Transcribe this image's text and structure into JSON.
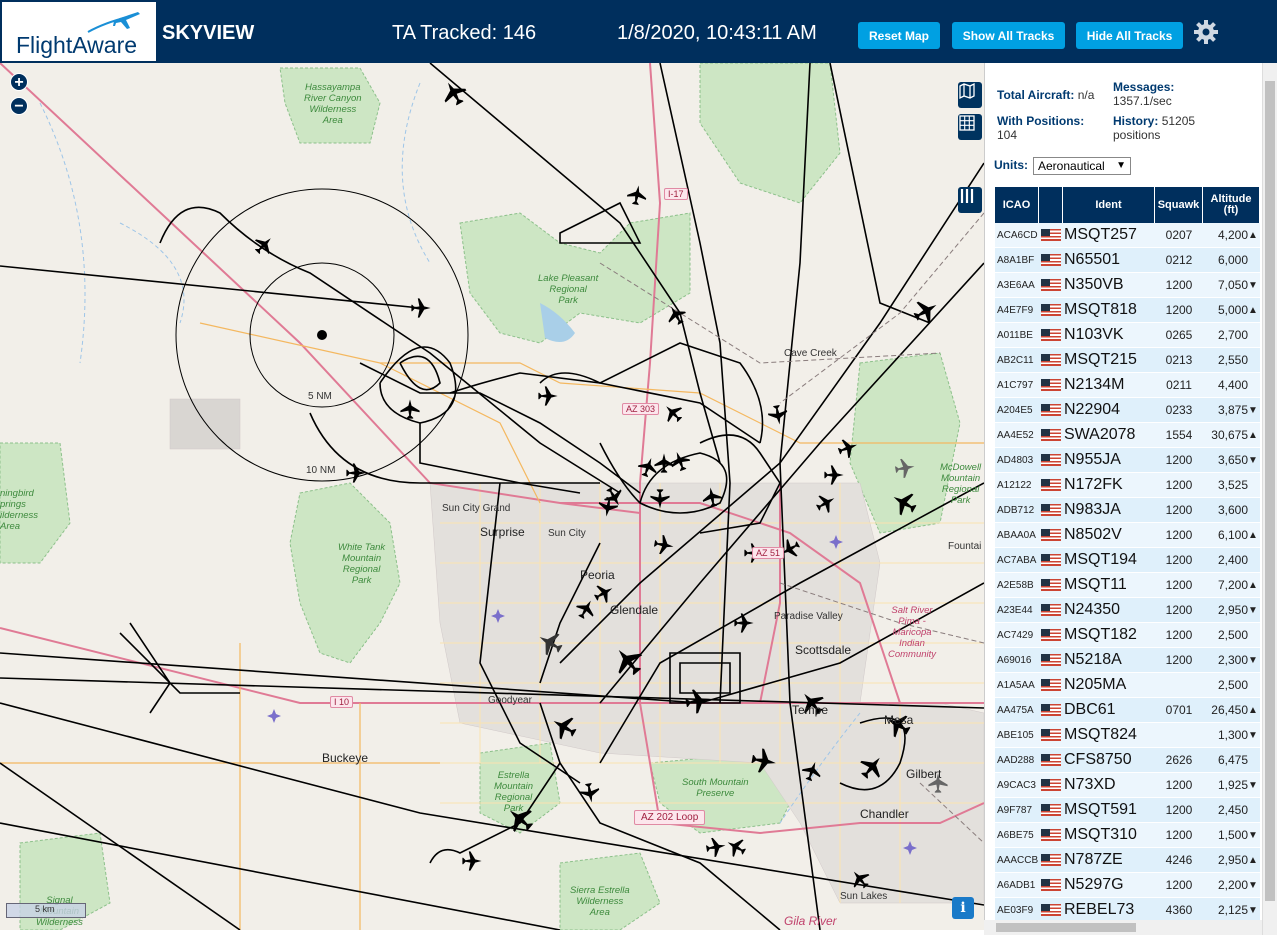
{
  "header": {
    "logo_text": "FlightAware",
    "app_title": "SKYVIEW",
    "tracked": "TA Tracked: 146",
    "clock": "1/8/2020, 10:43:11 AM",
    "reset_label": "Reset Map",
    "show_label": "Show All Tracks",
    "hide_label": "Hide All Tracks",
    "settings_icon": "gear-icon"
  },
  "map": {
    "zoom_in": "+",
    "zoom_out": "−",
    "scale": "5 km",
    "info": "i",
    "range_labels": [
      "5 NM",
      "10 NM"
    ],
    "places": [
      {
        "text": "Hassayampa\nRiver Canyon\nWilderness\nArea",
        "kind": "green"
      },
      {
        "text": "Lake Pleasant\nRegional\nPark",
        "kind": "green"
      },
      {
        "text": "White Tank\nMountain\nRegional\nPark",
        "kind": "green"
      },
      {
        "text": "McDowell\nMountain\nRegional\nPark",
        "kind": "green"
      },
      {
        "text": "Estrella\nMountain\nRegional\nPark",
        "kind": "green"
      },
      {
        "text": "South Mountain\nPreserve",
        "kind": "green"
      },
      {
        "text": "Sierra Estrella\nWilderness\nArea",
        "kind": "green"
      },
      {
        "text": "Signal\nMountain\nWilderness",
        "kind": "green"
      },
      {
        "text": "ningbird\nprings\nilderness\nArea",
        "kind": "green"
      },
      {
        "text": "Salt River\nPima -\nMaricopa\nIndian\nCommunity",
        "kind": "red"
      },
      {
        "text": "Cave Creek",
        "kind": "plain"
      },
      {
        "text": "Sun City Grand",
        "kind": "plain"
      },
      {
        "text": "Sun City",
        "kind": "plain"
      },
      {
        "text": "Surprise",
        "kind": "city"
      },
      {
        "text": "Peoria",
        "kind": "city"
      },
      {
        "text": "Glendale",
        "kind": "city"
      },
      {
        "text": "Paradise Valley",
        "kind": "plain"
      },
      {
        "text": "Scottsdale",
        "kind": "city"
      },
      {
        "text": "Goodyear",
        "kind": "plain"
      },
      {
        "text": "Buckeye",
        "kind": "city"
      },
      {
        "text": "Tempe",
        "kind": "city"
      },
      {
        "text": "Mesa",
        "kind": "city"
      },
      {
        "text": "Gilbert",
        "kind": "city"
      },
      {
        "text": "Chandler",
        "kind": "city"
      },
      {
        "text": "Sun Lakes",
        "kind": "plain"
      },
      {
        "text": "Gila River",
        "kind": "red"
      },
      {
        "text": "Fountai",
        "kind": "plain"
      }
    ],
    "shields": [
      "I-17",
      "AZ 303",
      "AZ 51",
      "I 10",
      "AZ 202 Loop"
    ]
  },
  "stats": {
    "total_label": "Total Aircraft:",
    "total_value": "n/a",
    "messages_label": "Messages:",
    "messages_value": "1357.1/sec",
    "positions_label": "With Positions:",
    "positions_value": "104",
    "history_label": "History:",
    "history_value": "51205",
    "history_unit": "positions"
  },
  "units": {
    "label": "Units:",
    "selected": "Aeronautical"
  },
  "table": {
    "headers": {
      "icao": "ICAO",
      "ident": "Ident",
      "squawk": "Squawk",
      "altitude": "Altitude (ft)"
    },
    "rows": [
      {
        "icao": "ACA6CD",
        "ident": "MSQT257",
        "squawk": "0207",
        "alt": "4,200",
        "trend": "▲"
      },
      {
        "icao": "A8A1BF",
        "ident": "N65501",
        "squawk": "0212",
        "alt": "6,000",
        "trend": ""
      },
      {
        "icao": "A3E6AA",
        "ident": "N350VB",
        "squawk": "1200",
        "alt": "7,050",
        "trend": "▼"
      },
      {
        "icao": "A4E7F9",
        "ident": "MSQT818",
        "squawk": "1200",
        "alt": "5,000",
        "trend": "▲"
      },
      {
        "icao": "A011BE",
        "ident": "N103VK",
        "squawk": "0265",
        "alt": "2,700",
        "trend": ""
      },
      {
        "icao": "AB2C11",
        "ident": "MSQT215",
        "squawk": "0213",
        "alt": "2,550",
        "trend": ""
      },
      {
        "icao": "A1C797",
        "ident": "N2134M",
        "squawk": "0211",
        "alt": "4,400",
        "trend": ""
      },
      {
        "icao": "A204E5",
        "ident": "N22904",
        "squawk": "0233",
        "alt": "3,875",
        "trend": "▼"
      },
      {
        "icao": "AA4E52",
        "ident": "SWA2078",
        "squawk": "1554",
        "alt": "30,675",
        "trend": "▲"
      },
      {
        "icao": "AD4803",
        "ident": "N955JA",
        "squawk": "1200",
        "alt": "3,650",
        "trend": "▼"
      },
      {
        "icao": "A12122",
        "ident": "N172FK",
        "squawk": "1200",
        "alt": "3,525",
        "trend": ""
      },
      {
        "icao": "ADB712",
        "ident": "N983JA",
        "squawk": "1200",
        "alt": "3,600",
        "trend": ""
      },
      {
        "icao": "ABAA0A",
        "ident": "N8502V",
        "squawk": "1200",
        "alt": "6,100",
        "trend": "▲"
      },
      {
        "icao": "AC7ABA",
        "ident": "MSQT194",
        "squawk": "1200",
        "alt": "2,400",
        "trend": ""
      },
      {
        "icao": "A2E58B",
        "ident": "MSQT11",
        "squawk": "1200",
        "alt": "7,200",
        "trend": "▲"
      },
      {
        "icao": "A23E44",
        "ident": "N24350",
        "squawk": "1200",
        "alt": "2,950",
        "trend": "▼"
      },
      {
        "icao": "AC7429",
        "ident": "MSQT182",
        "squawk": "1200",
        "alt": "2,500",
        "trend": ""
      },
      {
        "icao": "A69016",
        "ident": "N5218A",
        "squawk": "1200",
        "alt": "2,300",
        "trend": "▼"
      },
      {
        "icao": "A1A5AA",
        "ident": "N205MA",
        "squawk": "",
        "alt": "2,500",
        "trend": ""
      },
      {
        "icao": "AA475A",
        "ident": "DBC61",
        "squawk": "0701",
        "alt": "26,450",
        "trend": "▲"
      },
      {
        "icao": "ABE105",
        "ident": "MSQT824",
        "squawk": "",
        "alt": "1,300",
        "trend": "▼"
      },
      {
        "icao": "AAD288",
        "ident": "CFS8750",
        "squawk": "2626",
        "alt": "6,475",
        "trend": ""
      },
      {
        "icao": "A9CAC3",
        "ident": "N73XD",
        "squawk": "1200",
        "alt": "1,925",
        "trend": "▼"
      },
      {
        "icao": "A9F787",
        "ident": "MSQT591",
        "squawk": "1200",
        "alt": "2,450",
        "trend": ""
      },
      {
        "icao": "A6BE75",
        "ident": "MSQT310",
        "squawk": "1200",
        "alt": "1,500",
        "trend": "▼"
      },
      {
        "icao": "AAACCB",
        "ident": "N787ZE",
        "squawk": "4246",
        "alt": "2,950",
        "trend": "▲"
      },
      {
        "icao": "A6ADB1",
        "ident": "N5297G",
        "squawk": "1200",
        "alt": "2,200",
        "trend": "▼"
      },
      {
        "icao": "AE03F9",
        "ident": "REBEL73",
        "squawk": "4360",
        "alt": "2,125",
        "trend": "▼"
      }
    ]
  },
  "colors": {
    "header_bg": "#002f5d",
    "button_bg": "#00a0e2",
    "map_bg": "#f2efe9",
    "park_green": "#cde6c4",
    "track": "#000000"
  }
}
